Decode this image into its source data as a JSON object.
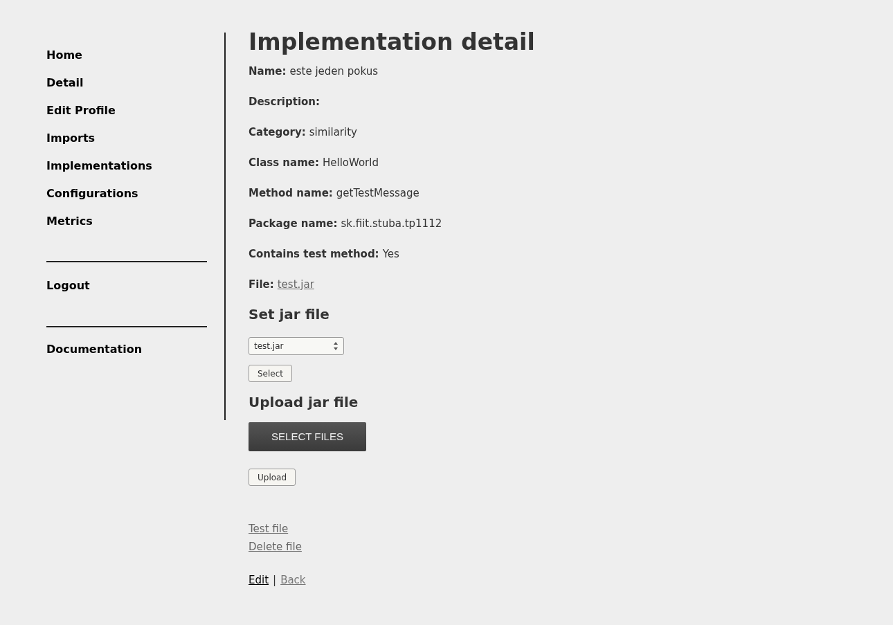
{
  "sidebar": {
    "nav": [
      "Home",
      "Detail",
      "Edit Profile",
      "Imports",
      "Implementations",
      "Configurations",
      "Metrics"
    ],
    "logout": "Logout",
    "documentation": "Documentation"
  },
  "title": "Implementation detail",
  "fields": [
    {
      "label": "Name:",
      "value": "este jeden pokus"
    },
    {
      "label": "Description:"
    },
    {
      "label": "Category:",
      "value": "similarity"
    },
    {
      "label": "Class name:",
      "value": "HelloWorld"
    },
    {
      "label": "Method name:",
      "value": "getTestMessage"
    },
    {
      "label": "Package name:",
      "value": "sk.fiit.stuba.tp1112"
    },
    {
      "label": "Contains test method:",
      "value": "Yes"
    },
    {
      "label": "File:",
      "link": "test.jar"
    }
  ],
  "set_jar": {
    "heading": "Set jar file",
    "select_value": "test.jar",
    "button": "Select"
  },
  "upload_jar": {
    "heading": "Upload jar file",
    "select_files": "SELECT FILES",
    "button": "Upload"
  },
  "file_links": [
    "Test file",
    "Delete file"
  ],
  "footer_links": [
    {
      "label": "Edit",
      "highlighted": true
    },
    {
      "label": "Back",
      "highlighted": false
    }
  ],
  "footer_separator": "|"
}
